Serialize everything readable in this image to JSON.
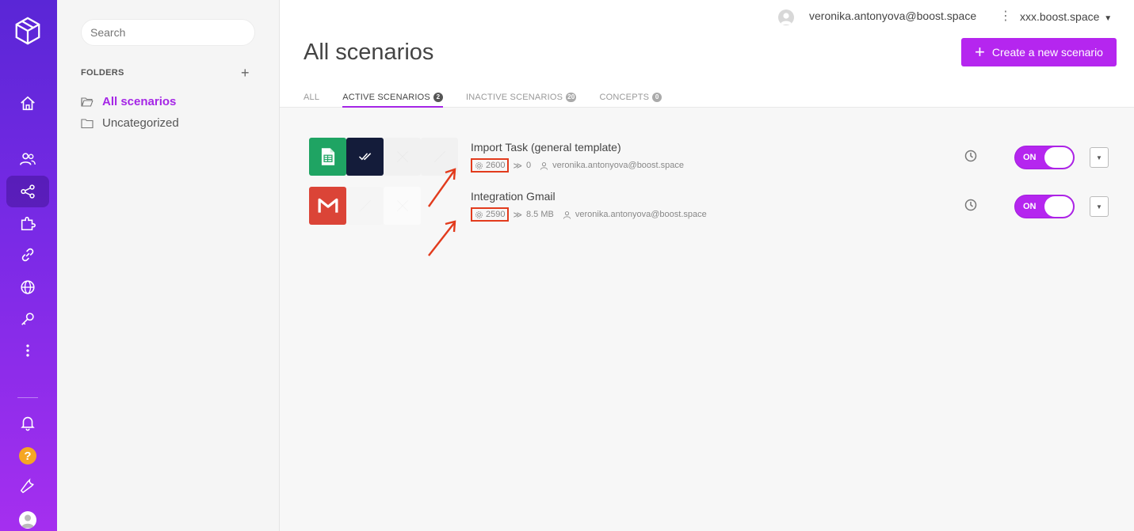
{
  "user": {
    "email": "veronika.antonyova@boost.space",
    "org": "xxx.boost.space"
  },
  "sidebar": {
    "search_placeholder": "Search",
    "folders_heading": "FOLDERS",
    "add_label": "+",
    "folders": [
      {
        "label": "All scenarios",
        "active": true
      },
      {
        "label": "Uncategorized",
        "active": false
      }
    ]
  },
  "page": {
    "title": "All scenarios",
    "create_label": "Create a new scenario",
    "tabs": [
      {
        "label": "ALL",
        "count": "",
        "active": false
      },
      {
        "label": "ACTIVE SCENARIOS",
        "count": "2",
        "active": true
      },
      {
        "label": "INACTIVE SCENARIOS",
        "count": "20",
        "active": false
      },
      {
        "label": "CONCEPTS",
        "count": "0",
        "active": false
      }
    ]
  },
  "scenarios": [
    {
      "name": "Import Task (general template)",
      "operations": "2600",
      "transfer": "0",
      "owner": "veronika.antonyova@boost.space",
      "toggle": "ON",
      "modules": [
        "sheets-icon",
        "check-icon"
      ]
    },
    {
      "name": "Integration Gmail",
      "operations": "2590",
      "transfer": "8.5 MB",
      "owner": "veronika.antonyova@boost.space",
      "toggle": "ON",
      "modules": [
        "gmail-icon"
      ]
    }
  ],
  "colors": {
    "accent": "#b526ef",
    "highlight": "#e23b1d"
  }
}
